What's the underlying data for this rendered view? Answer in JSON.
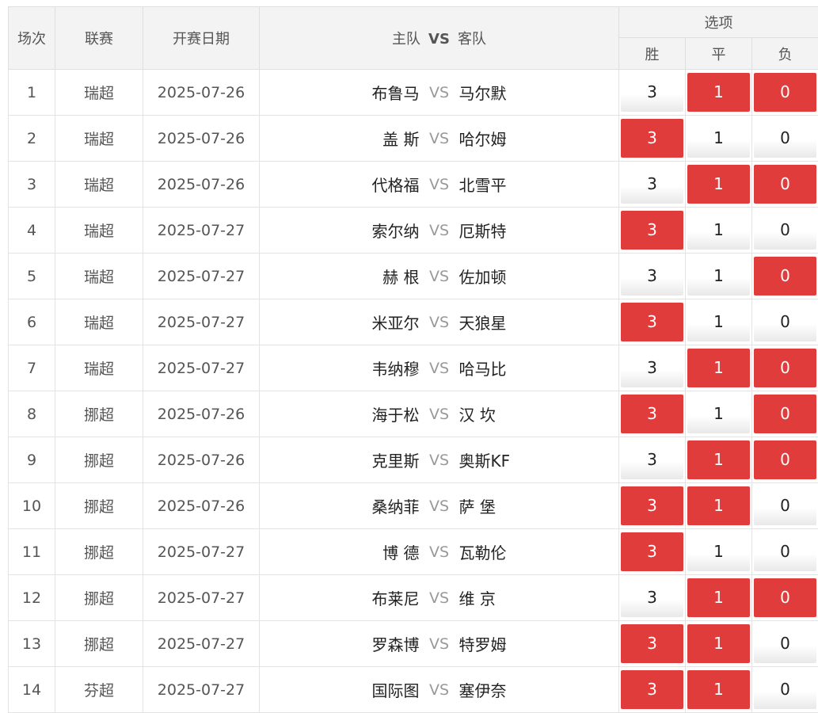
{
  "headers": {
    "num": "场次",
    "league": "联赛",
    "date": "开赛日期",
    "home": "主队",
    "vs": "VS",
    "away": "客队",
    "options": "选项",
    "win": "胜",
    "draw": "平",
    "lose": "负"
  },
  "colors": {
    "selected": "#e03c3c",
    "header_bg": "#f3f3f3"
  },
  "matches": [
    {
      "num": "1",
      "league": "瑞超",
      "date": "2025-07-26",
      "home": "布鲁马",
      "vs": "VS",
      "away": "马尔默",
      "win": "3",
      "draw": "1",
      "lose": "0",
      "win_sel": false,
      "draw_sel": true,
      "lose_sel": true
    },
    {
      "num": "2",
      "league": "瑞超",
      "date": "2025-07-26",
      "home": "盖 斯",
      "vs": "VS",
      "away": "哈尔姆",
      "win": "3",
      "draw": "1",
      "lose": "0",
      "win_sel": true,
      "draw_sel": false,
      "lose_sel": false
    },
    {
      "num": "3",
      "league": "瑞超",
      "date": "2025-07-26",
      "home": "代格福",
      "vs": "VS",
      "away": "北雪平",
      "win": "3",
      "draw": "1",
      "lose": "0",
      "win_sel": false,
      "draw_sel": true,
      "lose_sel": true
    },
    {
      "num": "4",
      "league": "瑞超",
      "date": "2025-07-27",
      "home": "索尔纳",
      "vs": "VS",
      "away": "厄斯特",
      "win": "3",
      "draw": "1",
      "lose": "0",
      "win_sel": true,
      "draw_sel": false,
      "lose_sel": false
    },
    {
      "num": "5",
      "league": "瑞超",
      "date": "2025-07-27",
      "home": "赫 根",
      "vs": "VS",
      "away": "佐加顿",
      "win": "3",
      "draw": "1",
      "lose": "0",
      "win_sel": false,
      "draw_sel": false,
      "lose_sel": true
    },
    {
      "num": "6",
      "league": "瑞超",
      "date": "2025-07-27",
      "home": "米亚尔",
      "vs": "VS",
      "away": "天狼星",
      "win": "3",
      "draw": "1",
      "lose": "0",
      "win_sel": true,
      "draw_sel": false,
      "lose_sel": false
    },
    {
      "num": "7",
      "league": "瑞超",
      "date": "2025-07-27",
      "home": "韦纳穆",
      "vs": "VS",
      "away": "哈马比",
      "win": "3",
      "draw": "1",
      "lose": "0",
      "win_sel": false,
      "draw_sel": true,
      "lose_sel": true
    },
    {
      "num": "8",
      "league": "挪超",
      "date": "2025-07-26",
      "home": "海于松",
      "vs": "VS",
      "away": "汉 坎",
      "win": "3",
      "draw": "1",
      "lose": "0",
      "win_sel": true,
      "draw_sel": false,
      "lose_sel": true
    },
    {
      "num": "9",
      "league": "挪超",
      "date": "2025-07-26",
      "home": "克里斯",
      "vs": "VS",
      "away": "奥斯KF",
      "win": "3",
      "draw": "1",
      "lose": "0",
      "win_sel": false,
      "draw_sel": true,
      "lose_sel": true
    },
    {
      "num": "10",
      "league": "挪超",
      "date": "2025-07-26",
      "home": "桑纳菲",
      "vs": "VS",
      "away": "萨 堡",
      "win": "3",
      "draw": "1",
      "lose": "0",
      "win_sel": true,
      "draw_sel": true,
      "lose_sel": false
    },
    {
      "num": "11",
      "league": "挪超",
      "date": "2025-07-27",
      "home": "博 德",
      "vs": "VS",
      "away": "瓦勒伦",
      "win": "3",
      "draw": "1",
      "lose": "0",
      "win_sel": true,
      "draw_sel": false,
      "lose_sel": false
    },
    {
      "num": "12",
      "league": "挪超",
      "date": "2025-07-27",
      "home": "布莱尼",
      "vs": "VS",
      "away": "维 京",
      "win": "3",
      "draw": "1",
      "lose": "0",
      "win_sel": false,
      "draw_sel": true,
      "lose_sel": true
    },
    {
      "num": "13",
      "league": "挪超",
      "date": "2025-07-27",
      "home": "罗森博",
      "vs": "VS",
      "away": "特罗姆",
      "win": "3",
      "draw": "1",
      "lose": "0",
      "win_sel": true,
      "draw_sel": true,
      "lose_sel": false
    },
    {
      "num": "14",
      "league": "芬超",
      "date": "2025-07-27",
      "home": "国际图",
      "vs": "VS",
      "away": "塞伊奈",
      "win": "3",
      "draw": "1",
      "lose": "0",
      "win_sel": true,
      "draw_sel": true,
      "lose_sel": false
    }
  ]
}
